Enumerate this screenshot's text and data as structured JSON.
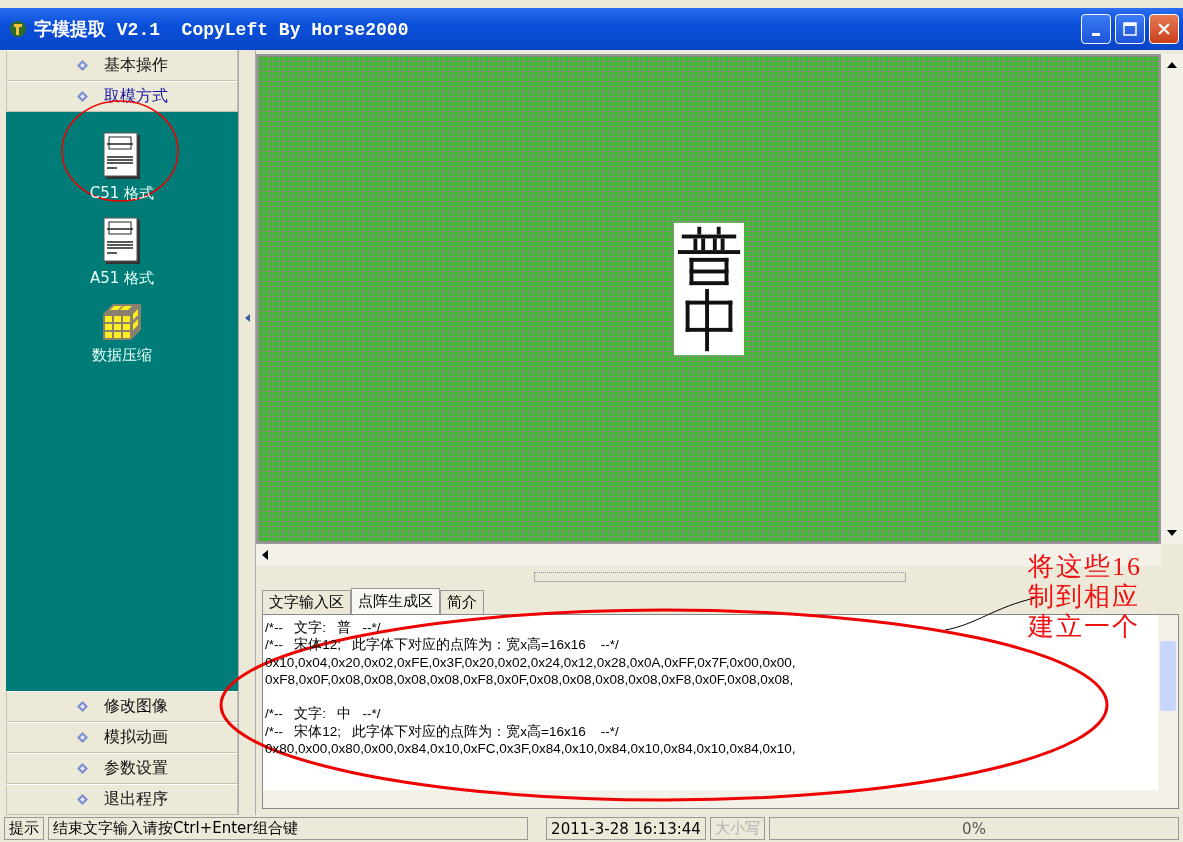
{
  "window": {
    "title": "字模提取 V2.1  CopyLeft By Horse2000"
  },
  "sidebar": {
    "top_headers": [
      {
        "label": "基本操作",
        "selected": false
      },
      {
        "label": "取模方式",
        "selected": true
      }
    ],
    "items": [
      {
        "label": "C51 格式",
        "kind": "c51"
      },
      {
        "label": "A51 格式",
        "kind": "a51"
      },
      {
        "label": "数据压缩",
        "kind": "cube"
      }
    ],
    "bottom_headers": [
      {
        "label": "修改图像",
        "selected": false
      },
      {
        "label": "模拟动画",
        "selected": false
      },
      {
        "label": "参数设置",
        "selected": false
      },
      {
        "label": "退出程序",
        "selected": false
      }
    ]
  },
  "tabs": [
    {
      "label": "文字输入区",
      "selected": false
    },
    {
      "label": "点阵生成区",
      "selected": true
    },
    {
      "label": "简介",
      "selected": false
    }
  ],
  "output_blocks": [
    {
      "lines": [
        "/*--   文字:   普   --*/",
        "/*--   宋体12;   此字体下对应的点阵为：宽x高=16x16    --*/",
        "0x10,0x04,0x20,0x02,0xFE,0x3F,0x20,0x02,0x24,0x12,0x28,0x0A,0xFF,0x7F,0x00,0x00,",
        "0xF8,0x0F,0x08,0x08,0x08,0x08,0xF8,0x0F,0x08,0x08,0x08,0x08,0xF8,0x0F,0x08,0x08,"
      ]
    },
    {
      "lines": [
        "/*--   文字:   中   --*/",
        "/*--   宋体12;   此字体下对应的点阵为：宽x高=16x16    --*/",
        "0x80,0x00,0x80,0x00,0x84,0x10,0xFC,0x3F,0x84,0x10,0x84,0x10,0x84,0x10,0x84,0x10,"
      ]
    }
  ],
  "annotation": [
    "将这些16",
    "制到相应",
    "建立一个"
  ],
  "status_bar": {
    "label": "提示",
    "message": "结束文字输入请按Ctrl+Enter组合键",
    "datetime": "2011-3-28 16:13:44",
    "caps": {
      "text": "大小写",
      "on": false
    },
    "progress": "0%"
  }
}
